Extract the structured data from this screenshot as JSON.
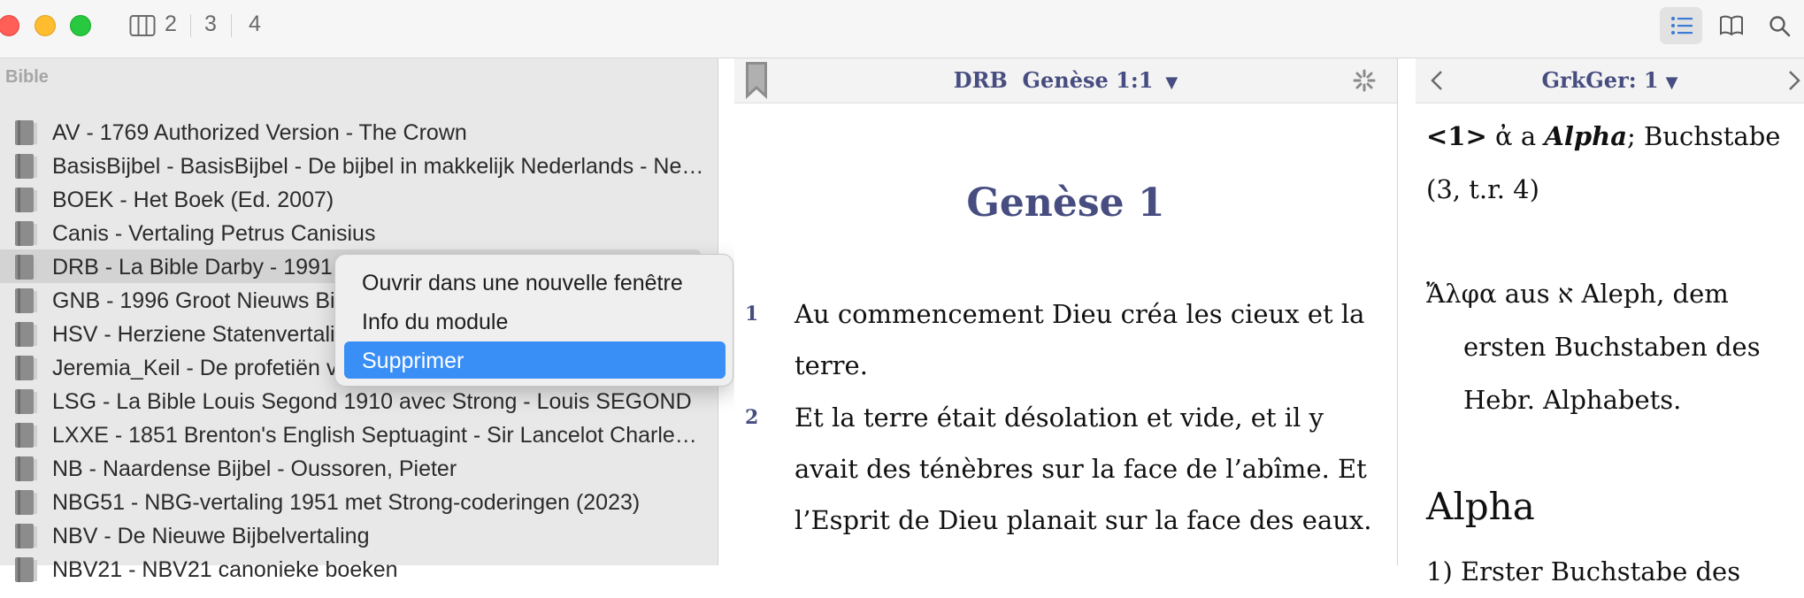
{
  "toolbar": {
    "columns": [
      "2",
      "3",
      "4"
    ]
  },
  "sidebar": {
    "section_title": "Bible",
    "items": [
      {
        "label": "AV - 1769 Authorized Version - The Crown"
      },
      {
        "label": "BasisBijbel - BasisBijbel - De bijbel in makkelijk Nederlands - Nederlands Bijbelgenootschap"
      },
      {
        "label": "BOEK - Het Boek (Ed. 2007)"
      },
      {
        "label": "Canis - Vertaling Petrus Canisius"
      },
      {
        "label": "DRB - La Bible Darby - 1991"
      },
      {
        "label": "GNB - 1996 Groot Nieuws Bijbel"
      },
      {
        "label": "HSV - Herziene Statenvertaling"
      },
      {
        "label": "Jeremia_Keil - De profetiën van Jeremia"
      },
      {
        "label": "LSG - La Bible Louis Segond 1910 avec Strong - Louis SEGOND"
      },
      {
        "label": "LXXE - 1851 Brenton's English Septuagint - Sir Lancelot Charles Lee Brenton"
      },
      {
        "label": "NB - Naardense Bijbel - Oussoren, Pieter"
      },
      {
        "label": "NBG51 - NBG-vertaling 1951 met Strong-coderingen (2023)"
      },
      {
        "label": "NBV - De Nieuwe Bijbelvertaling"
      },
      {
        "label": "NBV21 - NBV21 canonieke boeken"
      }
    ],
    "selected_index": 4
  },
  "context_menu": {
    "items": [
      "Ouvrir dans une nouvelle fenêtre",
      "Info du module",
      "Supprimer"
    ],
    "highlighted_index": 2
  },
  "bible_view": {
    "module": "DRB",
    "reference": "Genèse 1:1",
    "chapter_title": "Genèse 1",
    "verses": [
      {
        "num": "1",
        "text": "Au commencement Dieu créa les cieux et la terre."
      },
      {
        "num": "2",
        "text": "Et la terre était désolation et vide, et il y avait des ténèbres sur la face de l’abîme. Et l’Esprit de Dieu planait sur la face des eaux."
      }
    ]
  },
  "dictionary_view": {
    "title": "GrkGer: 1",
    "entry_ref": "<1>",
    "entry_greek": "ἀ",
    "entry_translit": "a",
    "entry_word": "Alpha",
    "entry_rest": "; Buchstabe (3, t.r. 4)",
    "paragraph": "Ἄλφα aus א Aleph, dem ersten Buchstaben des Hebr. Alphabets.",
    "heading": "Alpha",
    "def_line": "1) Erster Buchstabe des"
  },
  "colors": {
    "accent": "#474d80",
    "menu_highlight": "#3a8ff6",
    "sidebar_bg": "#e8e8e8"
  },
  "icons": [
    "columns-icon",
    "list-icon",
    "book-open-icon",
    "search-icon",
    "bookmark-icon",
    "sync-icon",
    "chevron-left-icon",
    "chevron-right-icon",
    "book-icon"
  ]
}
